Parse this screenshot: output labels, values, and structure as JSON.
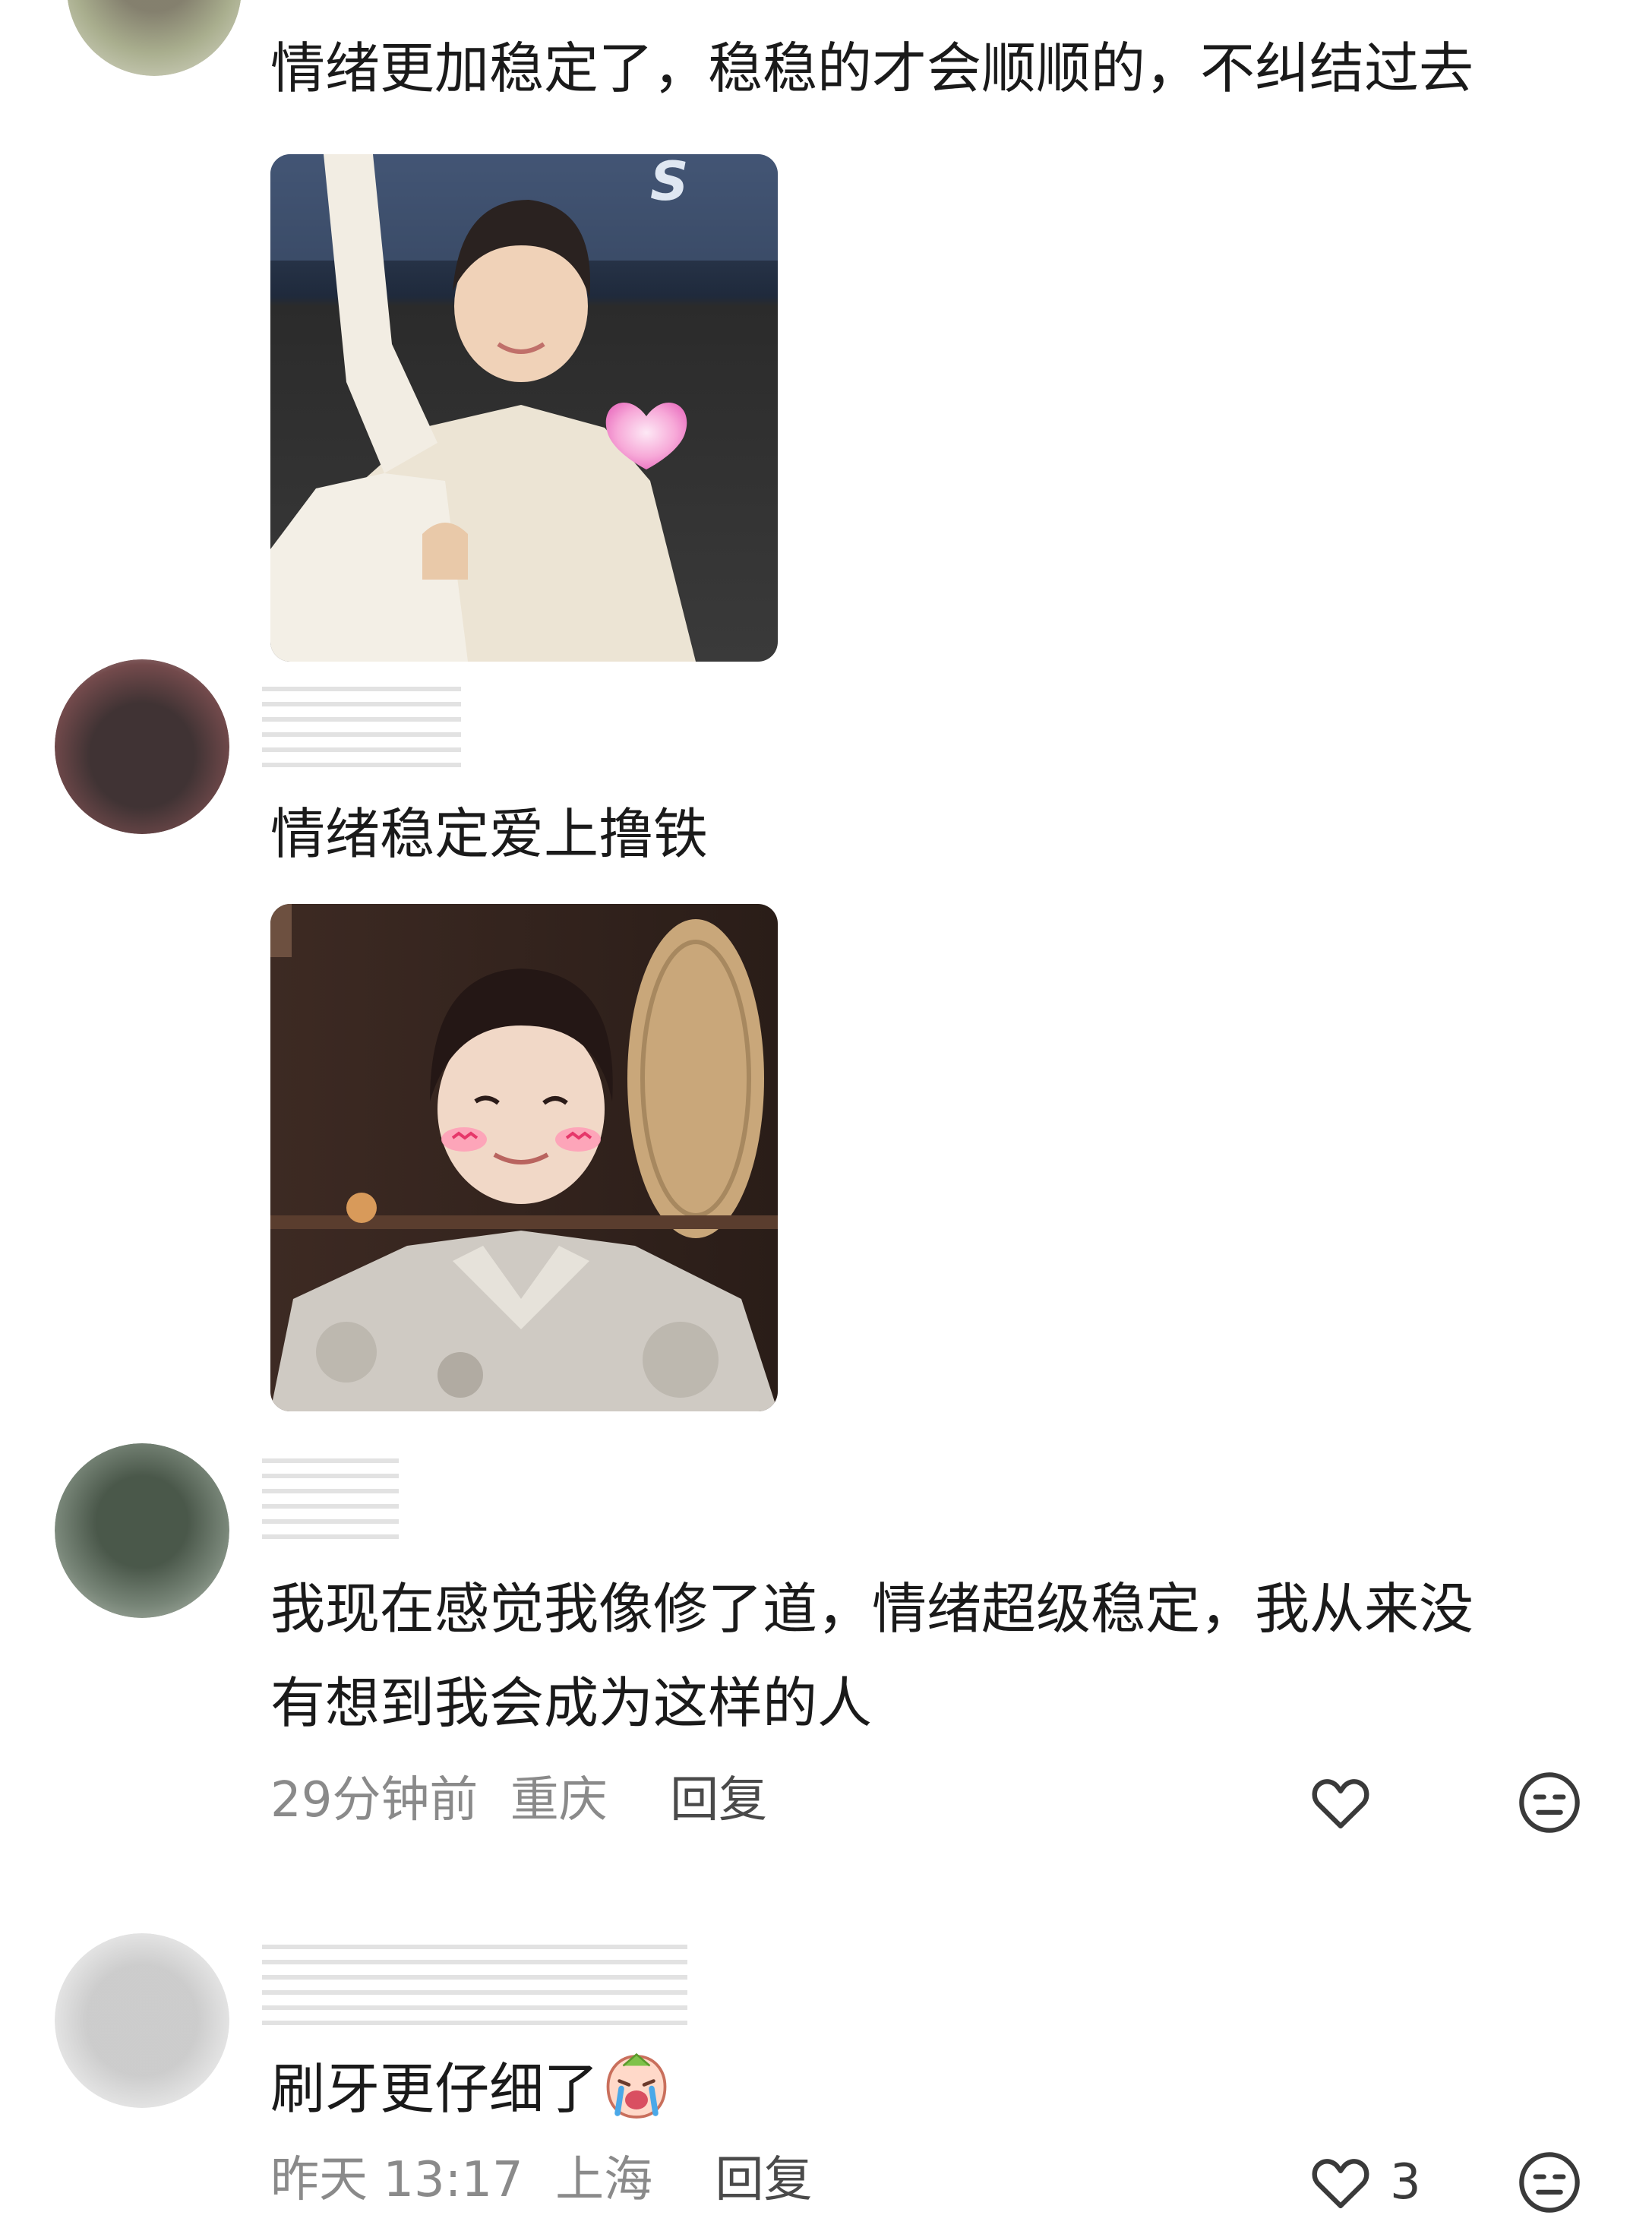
{
  "comments": [
    {
      "text": "情绪更加稳定了，稳稳的才会顺顺的，不纠结过去",
      "has_photo": true,
      "photo_desc": "young man in white jacket waving, pink heart sticker",
      "sticker": "heart-sticker"
    },
    {
      "text": "情绪稳定爱上撸铁",
      "has_photo": true,
      "photo_desc": "young man smiling with blush stickers, patterned shirt, round straw mat background"
    },
    {
      "text_line1": "我现在感觉我像修了道，情绪超级稳定，我从来没",
      "text_line2": "有想到我会成为这样的人",
      "time": "29分钟前",
      "location": "重庆",
      "reply_label": "回复",
      "like_icon": "heart-outline-icon",
      "dislike_icon": "neutral-face-icon"
    },
    {
      "text": "刷牙更仔细了",
      "emoji": "crying-emoji",
      "time": "昨天 13:17",
      "location": "上海",
      "reply_label": "回复",
      "like_count": "3",
      "like_icon": "heart-outline-icon",
      "dislike_icon": "neutral-face-icon"
    }
  ],
  "colors": {
    "text": "#1a1a1a",
    "meta": "#8a8a8a",
    "icon": "#3a3a3a"
  }
}
